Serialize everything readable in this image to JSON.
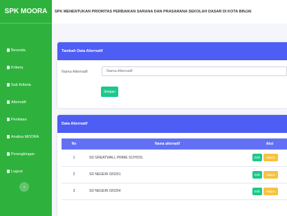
{
  "sidebar": {
    "brand": "SPK MOORA",
    "items": [
      {
        "label": "Beranda"
      },
      {
        "label": "Kriteria"
      },
      {
        "label": "Sub Kriteria"
      },
      {
        "label": "Alternatif"
      },
      {
        "label": "Penilaian"
      },
      {
        "label": "Analisa MOORA"
      },
      {
        "label": "Perangkingan"
      },
      {
        "label": "Logout"
      }
    ],
    "toggle_glyph": "‹"
  },
  "header": {
    "title": "SPK MENENTUKAN PRIORITAS PERBAIKAN SARANA DAN PRASARANA SEKOLAH DASAR DI KOTA BINJAI"
  },
  "form": {
    "heading": "Tambah Data Alternatif",
    "label": "Nama Alternatif",
    "placeholder": "Nama Alternatif",
    "save_label": "Simpan"
  },
  "table": {
    "heading": "Data Alternatif",
    "columns": [
      "No",
      "Nama alternatif",
      "Aksi"
    ],
    "rows": [
      {
        "no": "1",
        "name": "SD GREATWALL PRIME SCHOOL"
      },
      {
        "no": "2",
        "name": "SD NEGERI 020251"
      },
      {
        "no": "3",
        "name": "SD NEGERI 020254"
      }
    ],
    "edit_label": "Edit",
    "delete_label": "Hapus"
  },
  "colors": {
    "sidebar": "#2fb23d",
    "card_header": "#4e5df4",
    "success": "#1cc88a",
    "warning": "#f6c23e"
  }
}
